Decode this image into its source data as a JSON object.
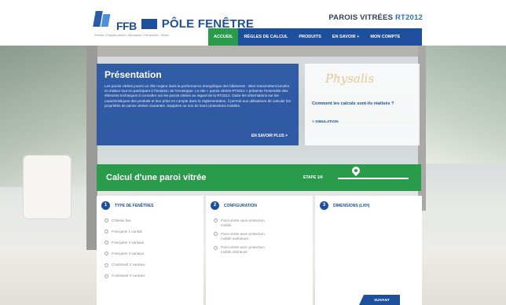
{
  "header": {
    "logo": {
      "ffb": "FFB",
      "pole": "PÔLE FENÊTRE",
      "tagline": "Fenêtre • Façades vitrées • Menuiserie • Fermetures • Stores"
    },
    "site_title_main": "PAROIS VITRÉES",
    "site_title_accent": "RT2012"
  },
  "nav": {
    "items": [
      {
        "label": "ACCUEIL",
        "active": true
      },
      {
        "label": "RÈGLES DE CALCUL"
      },
      {
        "label": "PRODUITS"
      },
      {
        "label": "EN SAVOIR +"
      },
      {
        "label": "MON COMPTE"
      }
    ]
  },
  "presentation": {
    "title": "Présentation",
    "text": "Les parois vitrées jouent un rôle majeur dans la performance énergétique des bâtiments : elles transmettent lumière et chaleur tout en participant à l'isolation de l'enveloppe. Le site « parois vitrées RT2012 » présente l'ensemble des éléments techniques à connaître sur les parois vitrées au regard de la RT2012. Outre les informations sur les caractéristiques des produits et leur prise en compte dans la réglementation, il permet aux utilisateurs de calculer les propriétés de parois vitrées courantes, équipées ou non de leurs protections mobiles.",
    "more_label": "EN SAVOIR PLUS  >"
  },
  "physalis": {
    "brand": "Physalis",
    "question": "Comment les calculs sont-ils réalisés ?",
    "simulation_label": ">  SIMULATION"
  },
  "calculator": {
    "title": "Calcul d'une paroi vitrée",
    "step_label": "ETAPE 1/4",
    "progress": 0.25
  },
  "steps": [
    {
      "number": "1",
      "title": "TYPE DE FENÊTRES",
      "options": [
        "Châssis fixe",
        "Française 1 vantail",
        "Française 2 vantaux",
        "Française 3 vantaux",
        "Coulissant 2 vantaux",
        "Coulissant 3 vantaux"
      ]
    },
    {
      "number": "2",
      "title": "CONFIGURATION",
      "options": [
        "Paroi vitrée sans protection mobile",
        "Paroi vitrée avec protection mobile extérieure",
        "Paroi vitrée avec protection mobile intérieure"
      ]
    },
    {
      "number": "3",
      "title": "DIMENSIONS (LXH)",
      "options": []
    }
  ],
  "next_label": "SUIVANT",
  "colors": {
    "primary_blue": "#1d4f9c",
    "accent_green": "#2a9a4b"
  }
}
